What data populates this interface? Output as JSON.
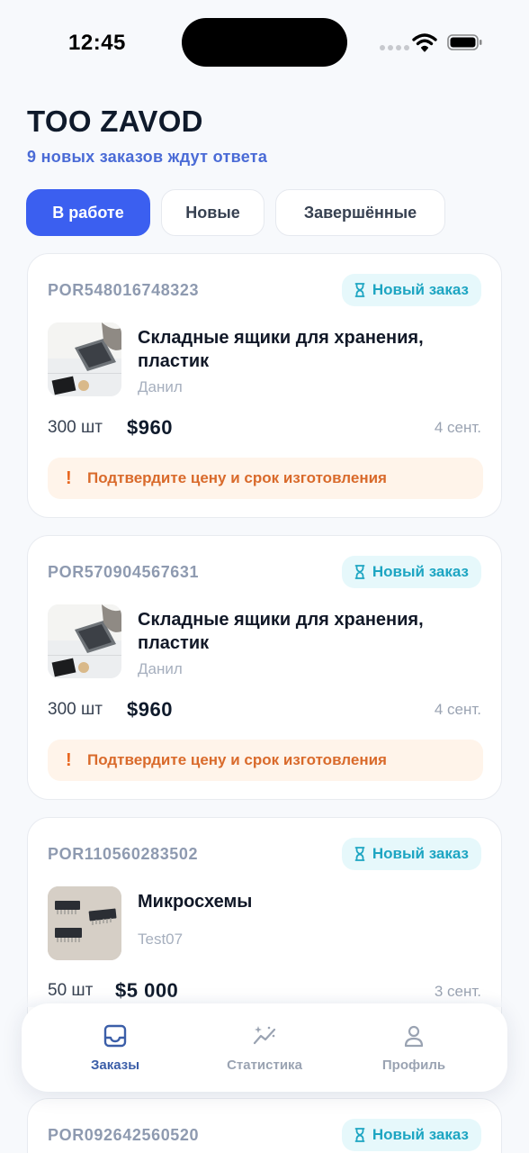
{
  "status_bar": {
    "time": "12:45"
  },
  "header": {
    "title": "TOO ZAVOD",
    "subtitle": "9 новых заказов ждут ответа"
  },
  "tabs": [
    {
      "label": "В работе",
      "active": true
    },
    {
      "label": "Новые",
      "active": false
    },
    {
      "label": "Завершённые",
      "active": false
    }
  ],
  "orders": [
    {
      "id": "POR548016748323",
      "status": "Новый заказ",
      "product": "Складные ящики для хранения, пластик",
      "buyer": "Данил",
      "qty": "300 шт",
      "price": "$960",
      "date": "4 сент.",
      "alert": "Подтвердите цену и срок изготовления",
      "alert_icon": "!"
    },
    {
      "id": "POR570904567631",
      "status": "Новый заказ",
      "product": "Складные ящики для хранения, пластик",
      "buyer": "Данил",
      "qty": "300 шт",
      "price": "$960",
      "date": "4 сент.",
      "alert": "Подтвердите цену и срок изготовления",
      "alert_icon": "!"
    },
    {
      "id": "POR110560283502",
      "status": "Новый заказ",
      "product": "Микросхемы",
      "buyer": "Test07",
      "qty": "50 шт",
      "price": "$5 000",
      "date": "3 сент."
    },
    {
      "id": "POR092642560520",
      "status": "Новый заказ"
    }
  ],
  "bottom_nav": [
    {
      "label": "Заказы",
      "icon": "inbox-icon",
      "active": true
    },
    {
      "label": "Статистика",
      "icon": "sparkle-chart-icon",
      "active": false
    },
    {
      "label": "Профиль",
      "icon": "user-icon",
      "active": false
    }
  ],
  "colors": {
    "accent": "#3b5ff0",
    "badge_bg": "#e6f8fb",
    "badge_text": "#1da5c2",
    "alert_bg": "#fff4ea",
    "alert_text": "#d96a2b"
  }
}
